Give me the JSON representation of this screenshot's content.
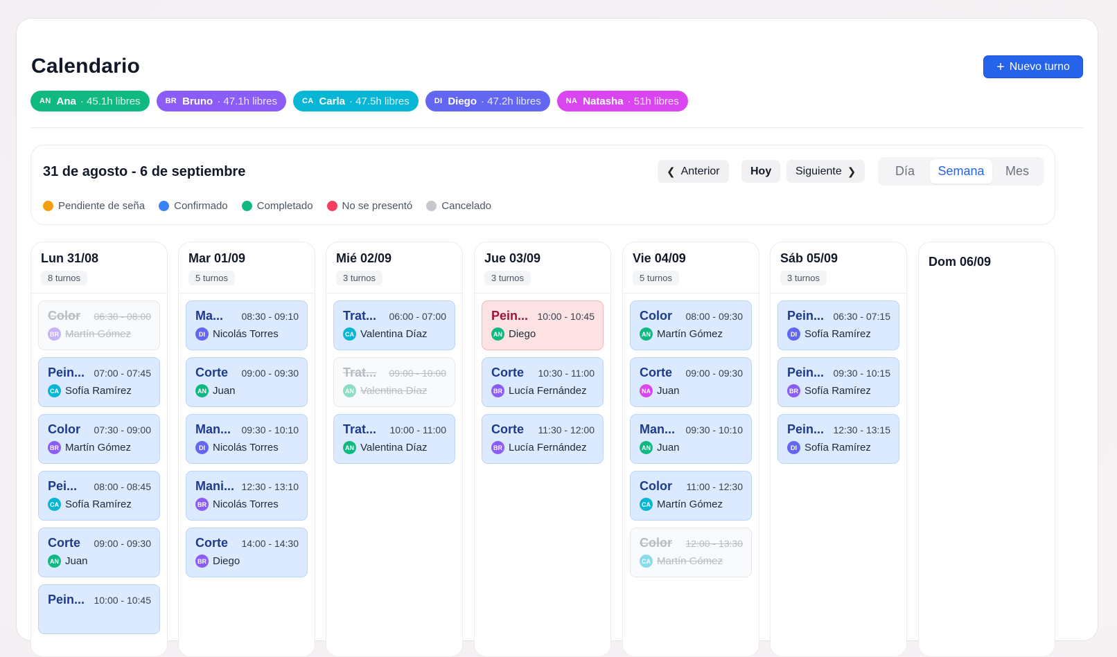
{
  "header": {
    "title": "Calendario",
    "new_button_label": "Nuevo turno"
  },
  "staff": [
    {
      "initials": "AN",
      "name": "Ana",
      "hours": "· 45.1h libres",
      "color": "#10b981"
    },
    {
      "initials": "BR",
      "name": "Bruno",
      "hours": "· 47.1h libres",
      "color": "#8b5cf6"
    },
    {
      "initials": "CA",
      "name": "Carla",
      "hours": "· 47.5h libres",
      "color": "#06b6d4"
    },
    {
      "initials": "DI",
      "name": "Diego",
      "hours": "· 47.2h libres",
      "color": "#6366f1"
    },
    {
      "initials": "NA",
      "name": "Natasha",
      "hours": "· 51h libres",
      "color": "#d946ef"
    }
  ],
  "toolbar": {
    "range": "31 de agosto - 6 de septiembre",
    "prev_label": "Anterior",
    "today_label": "Hoy",
    "next_label": "Siguiente",
    "views": [
      "Día",
      "Semana",
      "Mes"
    ],
    "active_view": "Semana"
  },
  "legend": [
    {
      "label": "Pendiente de seña",
      "color": "#f59e0b"
    },
    {
      "label": "Confirmado",
      "color": "#3b82f6"
    },
    {
      "label": "Completado",
      "color": "#10b981"
    },
    {
      "label": "No se presentó",
      "color": "#f43f5e"
    },
    {
      "label": "Cancelado",
      "color": "#c4c7cc"
    }
  ],
  "days": [
    {
      "date": "Lun 31/08",
      "count": "8 turnos",
      "appointments": [
        {
          "service": "Color",
          "time": "06:30 - 08:00",
          "staff": "BR",
          "client": "Martín Gómez",
          "status": "cancelado"
        },
        {
          "service": "Pein...",
          "time": "07:00 - 07:45",
          "staff": "CA",
          "client": "Sofía Ramírez",
          "status": "confirmado"
        },
        {
          "service": "Color",
          "time": "07:30 - 09:00",
          "staff": "BR",
          "client": "Martín Gómez",
          "status": "confirmado"
        },
        {
          "service": "Pei...",
          "time": "08:00 - 08:45",
          "staff": "CA",
          "client": "Sofía Ramírez",
          "status": "confirmado"
        },
        {
          "service": "Corte",
          "time": "09:00 - 09:30",
          "staff": "AN",
          "client": "Juan",
          "status": "confirmado"
        },
        {
          "service": "Pein...",
          "time": "10:00 - 10:45",
          "staff": "",
          "client": "",
          "status": "confirmado"
        }
      ]
    },
    {
      "date": "Mar 01/09",
      "count": "5 turnos",
      "appointments": [
        {
          "service": "Ma...",
          "time": "08:30 - 09:10",
          "staff": "DI",
          "client": "Nicolás Torres",
          "status": "confirmado"
        },
        {
          "service": "Corte",
          "time": "09:00 - 09:30",
          "staff": "AN",
          "client": "Juan",
          "status": "confirmado"
        },
        {
          "service": "Man...",
          "time": "09:30 - 10:10",
          "staff": "DI",
          "client": "Nicolás Torres",
          "status": "confirmado"
        },
        {
          "service": "Mani...",
          "time": "12:30 - 13:10",
          "staff": "BR",
          "client": "Nicolás Torres",
          "status": "confirmado"
        },
        {
          "service": "Corte",
          "time": "14:00 - 14:30",
          "staff": "BR",
          "client": "Diego",
          "status": "confirmado"
        }
      ]
    },
    {
      "date": "Mié 02/09",
      "count": "3 turnos",
      "appointments": [
        {
          "service": "Trat...",
          "time": "06:00 - 07:00",
          "staff": "CA",
          "client": "Valentina Díaz",
          "status": "confirmado"
        },
        {
          "service": "Trat...",
          "time": "09:00 - 10:00",
          "staff": "AN",
          "client": "Valentina Díaz",
          "status": "cancelado"
        },
        {
          "service": "Trat...",
          "time": "10:00 - 11:00",
          "staff": "AN",
          "client": "Valentina Díaz",
          "status": "confirmado"
        }
      ]
    },
    {
      "date": "Jue 03/09",
      "count": "3 turnos",
      "appointments": [
        {
          "service": "Pein...",
          "time": "10:00 - 10:45",
          "staff": "AN",
          "client": "Diego",
          "status": "no-show"
        },
        {
          "service": "Corte",
          "time": "10:30 - 11:00",
          "staff": "BR",
          "client": "Lucía Fernández",
          "status": "confirmado"
        },
        {
          "service": "Corte",
          "time": "11:30 - 12:00",
          "staff": "BR",
          "client": "Lucía Fernández",
          "status": "confirmado"
        }
      ]
    },
    {
      "date": "Vie 04/09",
      "count": "5 turnos",
      "appointments": [
        {
          "service": "Color",
          "time": "08:00 - 09:30",
          "staff": "AN",
          "client": "Martín Gómez",
          "status": "confirmado"
        },
        {
          "service": "Corte",
          "time": "09:00 - 09:30",
          "staff": "NA",
          "client": "Juan",
          "status": "confirmado"
        },
        {
          "service": "Man...",
          "time": "09:30 - 10:10",
          "staff": "AN",
          "client": "Juan",
          "status": "confirmado"
        },
        {
          "service": "Color",
          "time": "11:00 - 12:30",
          "staff": "CA",
          "client": "Martín Gómez",
          "status": "confirmado"
        },
        {
          "service": "Color",
          "time": "12:00 - 13:30",
          "staff": "CA",
          "client": "Martín Gómez",
          "status": "cancelado"
        }
      ]
    },
    {
      "date": "Sáb 05/09",
      "count": "3 turnos",
      "appointments": [
        {
          "service": "Pein...",
          "time": "06:30 - 07:15",
          "staff": "DI",
          "client": "Sofía Ramírez",
          "status": "confirmado"
        },
        {
          "service": "Pein...",
          "time": "09:30 - 10:15",
          "staff": "BR",
          "client": "Sofía Ramírez",
          "status": "confirmado"
        },
        {
          "service": "Pein...",
          "time": "12:30 - 13:15",
          "staff": "DI",
          "client": "Sofía Ramírez",
          "status": "confirmado"
        }
      ]
    },
    {
      "date": "Dom 06/09",
      "count": "",
      "appointments": []
    }
  ]
}
